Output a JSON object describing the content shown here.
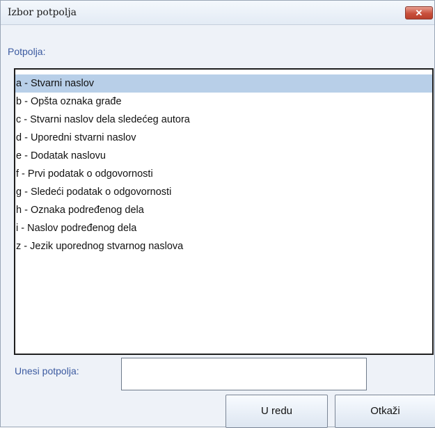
{
  "window": {
    "title": "Izbor potpolja",
    "close_label": "✕"
  },
  "subfields_label": "Potpolja:",
  "subfields": [
    {
      "label": "a - Stvarni naslov",
      "selected": true
    },
    {
      "label": "b - Opšta oznaka građe",
      "selected": false
    },
    {
      "label": "c - Stvarni naslov dela sledećeg autora",
      "selected": false
    },
    {
      "label": "d - Uporedni stvarni naslov",
      "selected": false
    },
    {
      "label": "e - Dodatak naslovu",
      "selected": false
    },
    {
      "label": "f - Prvi podatak o odgovornosti",
      "selected": false
    },
    {
      "label": "g - Sledeći podatak o odgovornosti",
      "selected": false
    },
    {
      "label": "h - Oznaka podređenog dela",
      "selected": false
    },
    {
      "label": "i - Naslov podređenog dela",
      "selected": false
    },
    {
      "label": "z - Jezik uporednog stvarnog naslova",
      "selected": false
    }
  ],
  "enter_label": "Unesi potpolja:",
  "enter_value": "",
  "buttons": {
    "ok": "U redu",
    "cancel": "Otkaži"
  }
}
